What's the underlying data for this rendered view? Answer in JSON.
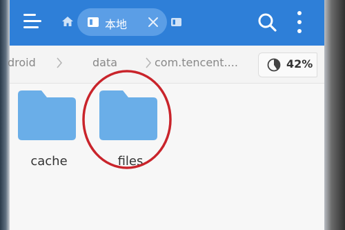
{
  "appbar": {
    "background_color": "#2e7fd8",
    "menu_icon": "hamburger-menu-icon",
    "home_icon": "home-icon",
    "active_tab": {
      "icon": "document-tab-icon",
      "label": "本地",
      "close_icon": "close-icon"
    },
    "second_tab_icon": "document-tab-icon",
    "search_icon": "search-icon",
    "more_icon": "more-vertical-icon"
  },
  "breadcrumb": {
    "items": [
      {
        "label": "droid"
      },
      {
        "label": "data"
      },
      {
        "label": "com.tencent...."
      }
    ],
    "separator_icon": "chevron-right-icon",
    "storage": {
      "icon": "pie-chart-icon",
      "percent_label": "42%",
      "percent_value": 42
    }
  },
  "files": [
    {
      "name": "cache",
      "icon": "folder-icon"
    },
    {
      "name": "files",
      "icon": "folder-icon",
      "annotated": true
    }
  ],
  "colors": {
    "folder": "#6aaee8",
    "annotation": "#c9242b",
    "tab_pill": "#5b9ee6"
  }
}
